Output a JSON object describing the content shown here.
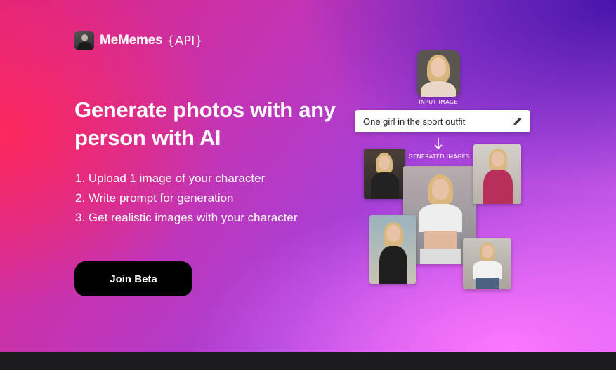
{
  "brand": {
    "name": "MeMemes",
    "suffix": "{API}"
  },
  "hero": {
    "headline": "Generate photos with any person with AI",
    "steps": [
      "1. Upload 1 image of your character",
      "2. Write prompt for generation",
      "3. Get realistic images with your character"
    ],
    "cta_label": "Join Beta"
  },
  "illustration": {
    "input_label": "INPUT IMAGE",
    "prompt_text": "One girl in the sport outfit",
    "generated_label": "GENERATED IMAGES"
  },
  "icons": {
    "edit": "pencil-icon",
    "flow": "arrow-down-icon"
  },
  "colors": {
    "cta_background": "#000000",
    "footer": "#1c1c1e"
  }
}
